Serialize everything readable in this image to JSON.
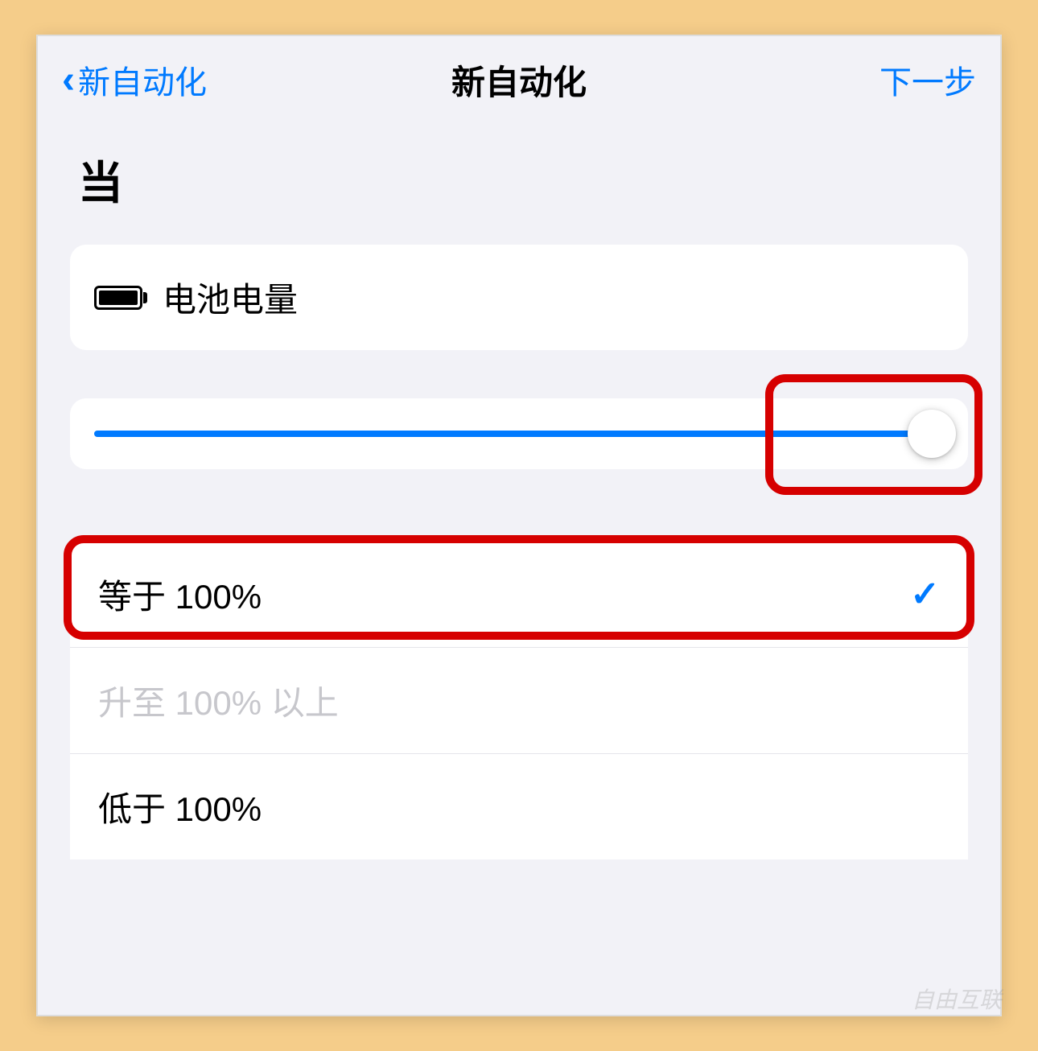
{
  "nav": {
    "back_label": "新自动化",
    "title": "新自动化",
    "next_label": "下一步"
  },
  "section_heading": "当",
  "trigger": {
    "label": "电池电量"
  },
  "slider": {
    "value": 100,
    "min": 0,
    "max": 100
  },
  "options": [
    {
      "label": "等于 100%",
      "selected": true,
      "disabled": false
    },
    {
      "label": "升至 100% 以上",
      "selected": false,
      "disabled": true
    },
    {
      "label": "低于 100%",
      "selected": false,
      "disabled": false
    }
  ],
  "colors": {
    "accent": "#007aff",
    "highlight": "#d60000",
    "background": "#f2f2f7",
    "frame_bg": "#f5cd8a"
  },
  "watermark": "自由互联"
}
